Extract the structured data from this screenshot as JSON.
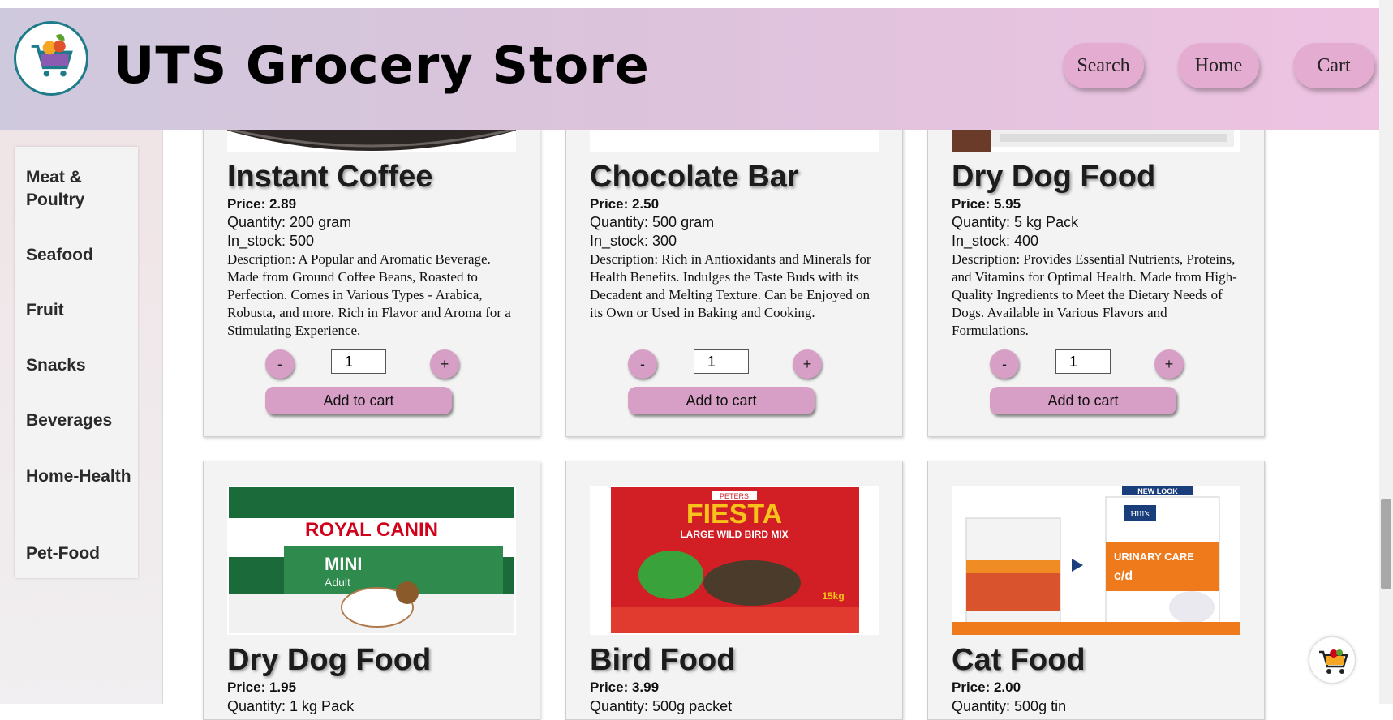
{
  "header": {
    "title": "UTS Grocery Store",
    "nav": {
      "search": "Search",
      "home": "Home",
      "cart": "Cart"
    },
    "logo_icon": "grocery-cart-logo-icon",
    "background": [
      "#cfc9dd",
      "#eec3e2"
    ]
  },
  "sidebar": {
    "items": [
      {
        "label": "Meat & Poultry"
      },
      {
        "label": "Seafood"
      },
      {
        "label": "Fruit"
      },
      {
        "label": "Snacks"
      },
      {
        "label": "Beverages"
      },
      {
        "label": "Home-Health"
      },
      {
        "label": "Pet-Food"
      }
    ]
  },
  "products": [
    {
      "name": "Instant Coffee",
      "price": "Price: 2.89",
      "quantity": "Quantity: 200 gram",
      "stock": "In_stock: 500",
      "description": "Description: A Popular and Aromatic Beverage. Made from Ground Coffee Beans, Roasted to Perfection. Comes in Various Types - Arabica, Robusta, and more. Rich in Flavor and Aroma for a Stimulating Experience.",
      "qty_value": "1",
      "minus": "-",
      "plus": "+",
      "add_label": "Add to cart"
    },
    {
      "name": "Chocolate Bar",
      "price": "Price: 2.50",
      "quantity": "Quantity: 500 gram",
      "stock": "In_stock: 300",
      "description": "Description: Rich in Antioxidants and Minerals for Health Benefits. Indulges the Taste Buds with its Decadent and Melting Texture. Can be Enjoyed on its Own or Used in Baking and Cooking.",
      "qty_value": "1",
      "minus": "-",
      "plus": "+",
      "add_label": "Add to cart"
    },
    {
      "name": "Dry Dog Food",
      "price": "Price: 5.95",
      "quantity": "Quantity: 5 kg Pack",
      "stock": "In_stock: 400",
      "description": "Description: Provides Essential Nutrients, Proteins, and Vitamins for Optimal Health. Made from High-Quality Ingredients to Meet the Dietary Needs of Dogs. Available in Various Flavors and Formulations.",
      "qty_value": "1",
      "minus": "-",
      "plus": "+",
      "add_label": "Add to cart"
    },
    {
      "name": "Dry Dog Food",
      "price": "Price: 1.95",
      "quantity": "Quantity: 1 kg Pack",
      "image_text": {
        "brand": "ROYAL CANIN",
        "line": "MINI",
        "sub": "Adult"
      }
    },
    {
      "name": "Bird Food",
      "price": "Price: 3.99",
      "quantity": "Quantity: 500g packet",
      "image_text": {
        "brand": "PETERS",
        "line": "FIESTA",
        "sub": "LARGE WILD BIRD MIX",
        "weight": "15kg"
      }
    },
    {
      "name": "Cat Food",
      "price": "Price: 2.00",
      "quantity": "Quantity: 500g tin",
      "image_text": {
        "badge": "NEW LOOK",
        "brand": "Hill's",
        "line": "URINARY CARE",
        "sub": "c/d"
      }
    }
  ],
  "colors": {
    "accent": "#d79fc5",
    "nav_button": "#e5acd2"
  },
  "floating_cart_icon": "shopping-cart-icon"
}
